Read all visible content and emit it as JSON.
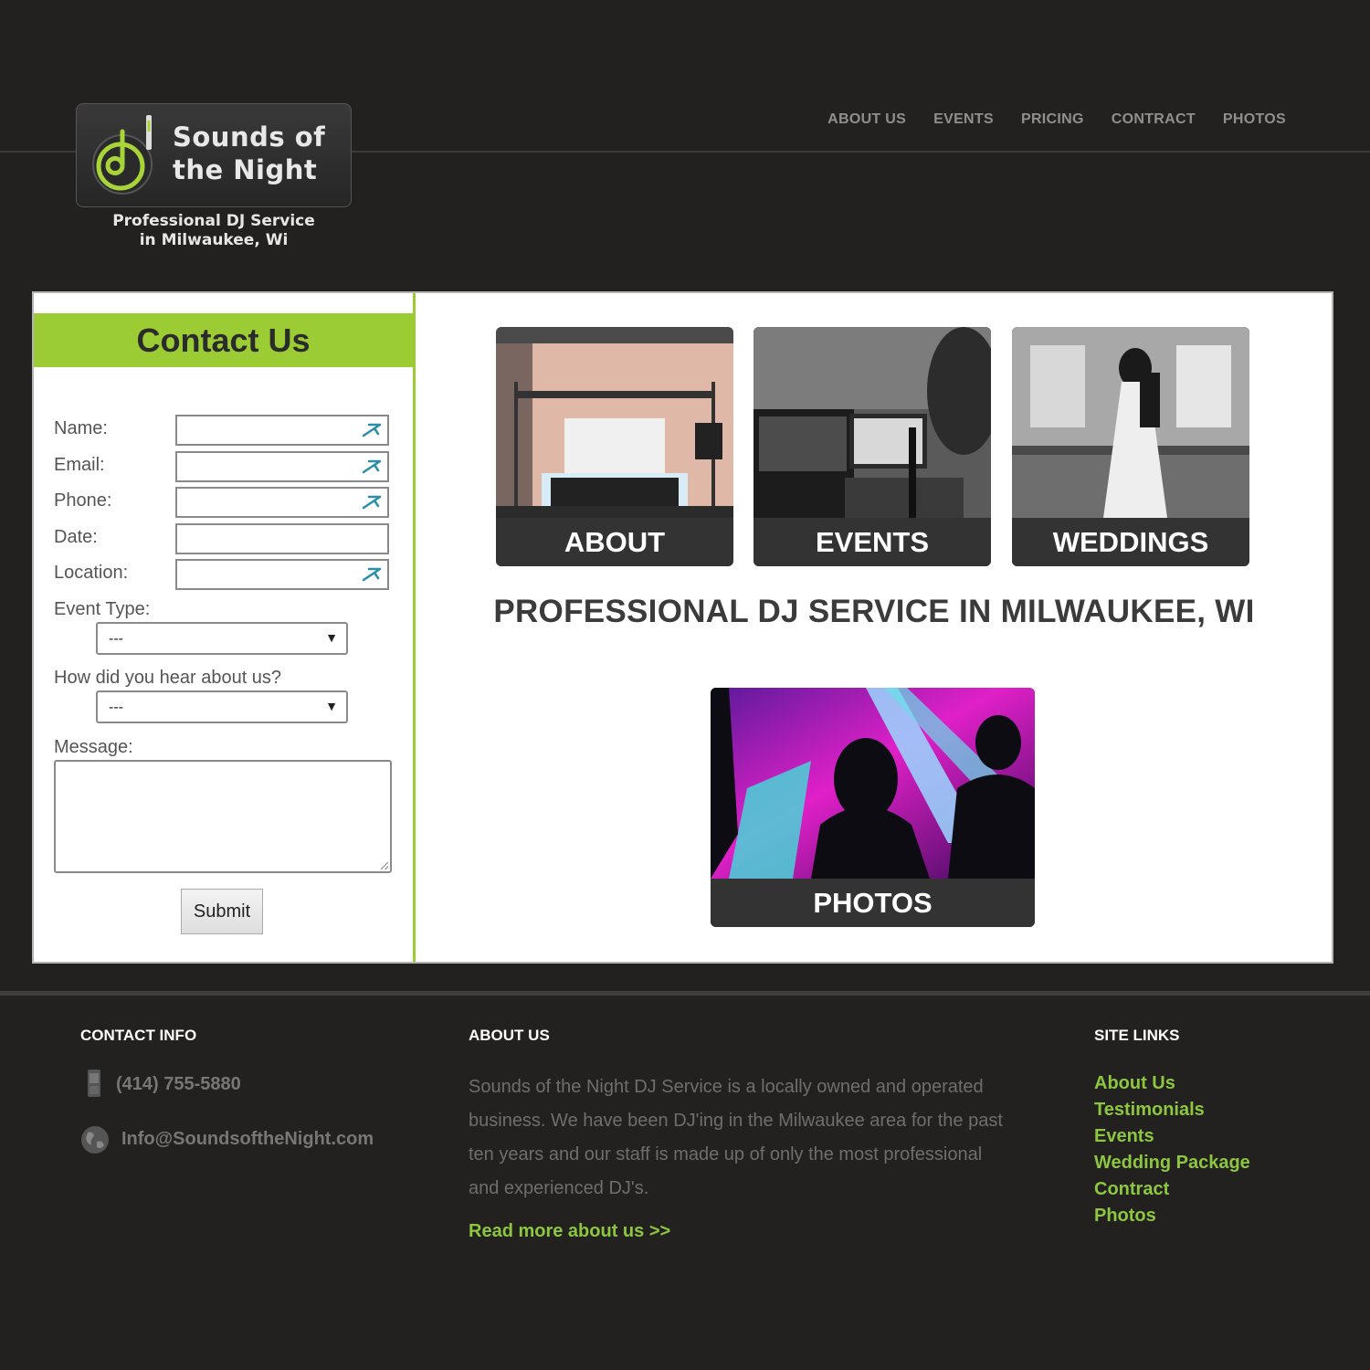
{
  "brand": {
    "name_line1": "Sounds of",
    "name_line2": "the Night",
    "tagline_line1": "Professional DJ Service",
    "tagline_line2": "in Milwaukee, Wi",
    "accent": "#9ccc34"
  },
  "nav": [
    "ABOUT US",
    "EVENTS",
    "PRICING",
    "CONTRACT",
    "PHOTOS"
  ],
  "contact_form": {
    "title": "Contact Us",
    "name_label": "Name:",
    "email_label": "Email:",
    "phone_label": "Phone:",
    "date_label": "Date:",
    "location_label": "Location:",
    "event_type_label": "Event Type:",
    "event_type_value": "---",
    "hear_label": "How did you hear about us?",
    "hear_value": "---",
    "message_label": "Message:",
    "submit_label": "Submit"
  },
  "tiles": [
    "ABOUT",
    "EVENTS",
    "WEDDINGS",
    "PHOTOS"
  ],
  "headline": "PROFESSIONAL DJ SERVICE IN MILWAUKEE, WI",
  "footer": {
    "contact_heading": "CONTACT INFO",
    "phone": "(414) 755-5880",
    "email": "Info@SoundsoftheNight.com",
    "about_heading": "ABOUT US",
    "about_text": "Sounds of the Night DJ Service is a locally owned and operated business. We have been DJ'ing in the Milwaukee area for the past ten years and our staff is made up of only the most professional and experienced DJ's.",
    "read_more": "Read more about us >>",
    "links_heading": "SITE LINKS",
    "links": [
      "About Us",
      "Testimonials",
      "Events",
      "Wedding Package",
      "Contract",
      "Photos"
    ]
  }
}
